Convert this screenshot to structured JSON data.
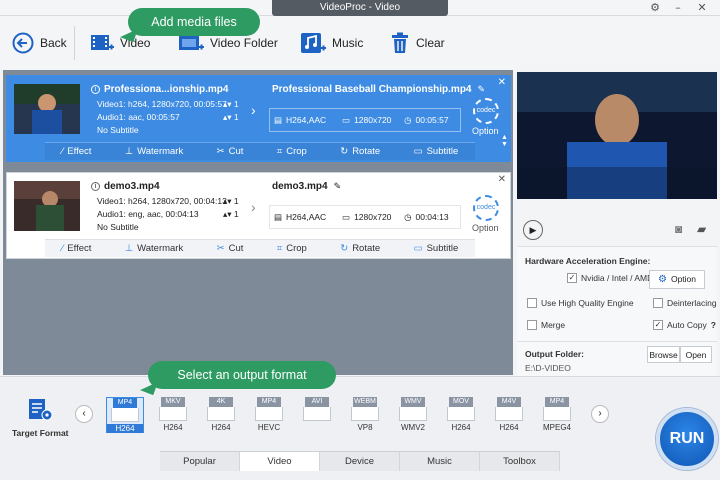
{
  "window": {
    "title": "VideoProc - Video"
  },
  "toolbar": {
    "back": "Back",
    "video": "Video",
    "video_folder": "Video Folder",
    "music": "Music",
    "clear": "Clear"
  },
  "callouts": {
    "add_media": "Add media files",
    "select_output": "Select an output format"
  },
  "files": [
    {
      "name": "Professiona...ionship.mp4",
      "video_info": "Video1: h264, 1280x720, 00:05:57",
      "audio_info": "Audio1: aac, 00:05:57",
      "subtitle": "No Subtitle",
      "video_count": "1",
      "audio_count": "1",
      "out_name": "Professional Baseball Championship.mp4",
      "out_codec": "H264,AAC",
      "out_res": "1280x720",
      "out_dur": "00:05:57",
      "option": "Option",
      "codec_badge": "codec"
    },
    {
      "name": "demo3.mp4",
      "video_info": "Video1: h264, 1280x720, 00:04:13",
      "audio_info": "Audio1: eng, aac, 00:04:13",
      "subtitle": "No Subtitle",
      "video_count": "1",
      "audio_count": "1",
      "out_name": "demo3.mp4",
      "out_codec": "H264,AAC",
      "out_res": "1280x720",
      "out_dur": "00:04:13",
      "option": "Option",
      "codec_badge": "codec"
    }
  ],
  "edit_actions": {
    "effect": "Effect",
    "watermark": "Watermark",
    "cut": "Cut",
    "crop": "Crop",
    "rotate": "Rotate",
    "subtitle": "Subtitle"
  },
  "settings": {
    "hw_label": "Hardware Acceleration Engine:",
    "hw_vendor": "Nvidia / Intel / AMD",
    "option": "Option",
    "high_quality": "Use High Quality Engine",
    "deinterlacing": "Deinterlacing",
    "merge": "Merge",
    "auto_copy": "Auto Copy",
    "help": "?",
    "output_folder_label": "Output Folder:",
    "output_folder_path": "E:\\D-VIDEO",
    "browse": "Browse",
    "open": "Open"
  },
  "target_format": "Target Format",
  "formats": [
    {
      "tag": "MP4",
      "codec": "H264",
      "selected": true
    },
    {
      "tag": "MKV",
      "codec": "H264"
    },
    {
      "tag": "4K",
      "codec": "H264"
    },
    {
      "tag": "MP4",
      "codec": "HEVC"
    },
    {
      "tag": "AVI",
      "codec": ""
    },
    {
      "tag": "WEBM",
      "codec": "VP8"
    },
    {
      "tag": "WMV",
      "codec": "WMV2"
    },
    {
      "tag": "MOV",
      "codec": "H264"
    },
    {
      "tag": "M4V",
      "codec": "H264"
    },
    {
      "tag": "MP4",
      "codec": "MPEG4"
    }
  ],
  "tabs": [
    "Popular",
    "Video",
    "Device",
    "Music",
    "Toolbox"
  ],
  "active_tab": "Video",
  "run": "RUN",
  "colors": {
    "accent": "#3d8be2",
    "callout": "#2e9b63",
    "run": "#1565c0"
  }
}
